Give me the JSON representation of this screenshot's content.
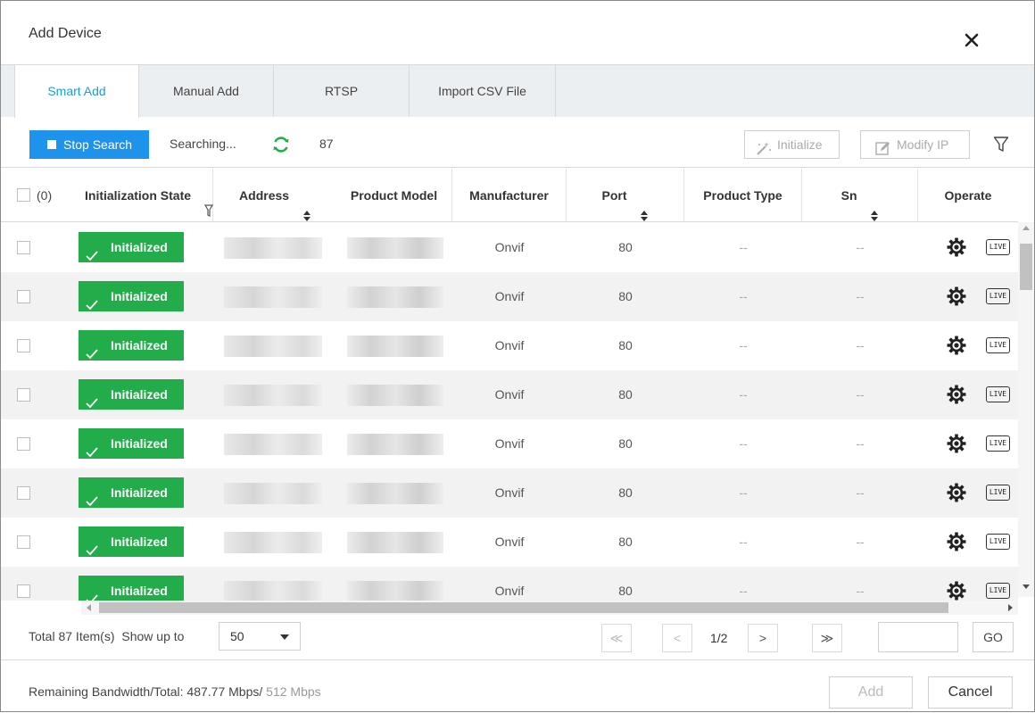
{
  "dialog": {
    "title": "Add Device"
  },
  "tabs": [
    {
      "label": "Smart Add",
      "active": true
    },
    {
      "label": "Manual Add",
      "active": false
    },
    {
      "label": "RTSP",
      "active": false
    },
    {
      "label": "Import CSV File",
      "active": false
    }
  ],
  "toolbar": {
    "stop_search_label": "Stop Search",
    "status_text": "Searching...",
    "found_count": "87",
    "initialize_label": "Initialize",
    "modify_ip_label": "Modify IP"
  },
  "table": {
    "select_all_label": "(0)",
    "columns": [
      "Initialization State",
      "Address",
      "Product Model",
      "Manufacturer",
      "Port",
      "Product Type",
      "Sn",
      "Operate"
    ],
    "rows": [
      {
        "state": "Initialized",
        "manufacturer": "Onvif",
        "port": "80",
        "product_type": "--",
        "sn": "--"
      },
      {
        "state": "Initialized",
        "manufacturer": "Onvif",
        "port": "80",
        "product_type": "--",
        "sn": "--"
      },
      {
        "state": "Initialized",
        "manufacturer": "Onvif",
        "port": "80",
        "product_type": "--",
        "sn": "--"
      },
      {
        "state": "Initialized",
        "manufacturer": "Onvif",
        "port": "80",
        "product_type": "--",
        "sn": "--"
      },
      {
        "state": "Initialized",
        "manufacturer": "Onvif",
        "port": "80",
        "product_type": "--",
        "sn": "--"
      },
      {
        "state": "Initialized",
        "manufacturer": "Onvif",
        "port": "80",
        "product_type": "--",
        "sn": "--"
      },
      {
        "state": "Initialized",
        "manufacturer": "Onvif",
        "port": "80",
        "product_type": "--",
        "sn": "--"
      },
      {
        "state": "Initialized",
        "manufacturer": "Onvif",
        "port": "80",
        "product_type": "--",
        "sn": "--"
      }
    ],
    "live_label": "LIVE"
  },
  "pager": {
    "total_label": "Total 87 Item(s)",
    "show_up_to_label": "Show up to",
    "page_size": "50",
    "page_info": "1/2",
    "go_label": "GO",
    "first_glyph": "≪",
    "prev_glyph": "<",
    "next_glyph": ">",
    "last_glyph": "≫"
  },
  "footer": {
    "bandwidth_label": "Remaining Bandwidth/Total: 487.77 Mbps/",
    "bandwidth_total": " 512 Mbps",
    "add_label": "Add",
    "cancel_label": "Cancel"
  },
  "colors": {
    "accent": "#1e93ec",
    "initialized_green": "#22ad4a",
    "tab_active_text": "#1c9be6"
  },
  "icons": {
    "close": "close-icon",
    "refresh": "refresh-icon",
    "initialize": "initialize-icon",
    "modify_ip": "edit-icon",
    "filter": "filter-icon",
    "gear": "gear-icon",
    "live": "live-icon"
  }
}
